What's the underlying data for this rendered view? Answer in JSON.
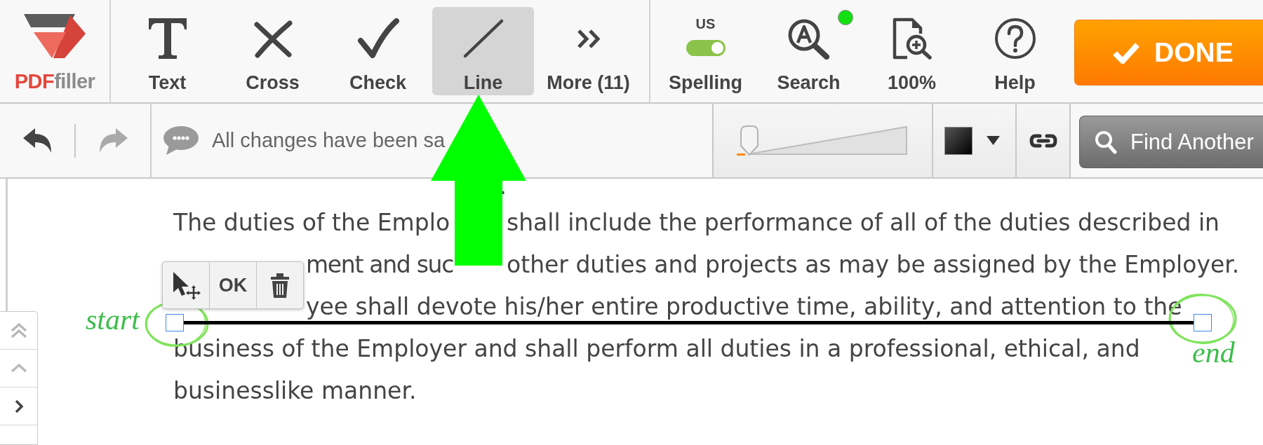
{
  "logo": {
    "wordmark": [
      {
        "text": "PDF",
        "color": "#e2483d"
      },
      {
        "text": "filler",
        "color": "#8c8c8c"
      }
    ]
  },
  "tools": [
    {
      "kind": "text",
      "label": "Text",
      "selected": false
    },
    {
      "kind": "cross",
      "label": "Cross",
      "selected": false
    },
    {
      "kind": "check",
      "label": "Check",
      "selected": false
    },
    {
      "kind": "line",
      "label": "Line",
      "selected": true
    },
    {
      "kind": "more",
      "label": "More (11)",
      "selected": false
    }
  ],
  "utilities": [
    {
      "kind": "spelling",
      "label": "Spelling",
      "language": "US",
      "on": true
    },
    {
      "kind": "search",
      "label": "Search",
      "indicator": true
    },
    {
      "kind": "zoom",
      "label": "100%"
    },
    {
      "kind": "help",
      "label": "Help"
    }
  ],
  "done_button": {
    "label": "DONE"
  },
  "edit_bar": {
    "undo": {
      "disabled": false
    },
    "redo": {
      "disabled": true
    },
    "status_message": "All changes have been sa",
    "line_thickness": {
      "level": 0.05
    },
    "find_button": {
      "label": "Find Another"
    }
  },
  "side_nav": [
    {
      "kind": "double-up"
    },
    {
      "kind": "up"
    },
    {
      "kind": "right"
    }
  ],
  "document": {
    "fragment": ".",
    "lines": [
      [
        "The duties of the Emplo",
        "shall include the performance of all of the duties described in"
      ],
      [
        "ment and suc",
        "other duties and projects as may be assigned by the Employer."
      ],
      [
        "yee shall devote his/her entire productive time, ability, and attention to the"
      ],
      [
        "business of the Employer and shall perform all duties in a professional, ethical, and"
      ],
      [
        "businesslike manner."
      ]
    ]
  },
  "line_editor": {
    "ok_label": "OK"
  },
  "annotations": {
    "start_label": "start",
    "end_label": "end"
  }
}
